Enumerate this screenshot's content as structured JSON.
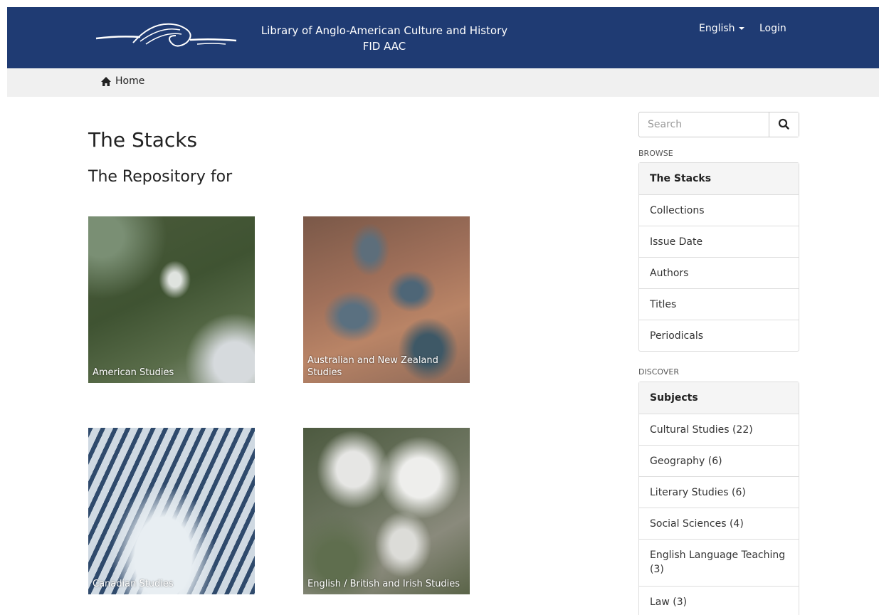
{
  "header": {
    "title_line1": "Library of Anglo-American Culture and History",
    "title_line2": "FID AAC",
    "language_label": "English",
    "login_label": "Login",
    "bg_color": "#1f3b73"
  },
  "breadcrumb": {
    "home_label": "Home",
    "icon": "home-icon"
  },
  "main": {
    "title": "The Stacks",
    "subtitle": "The Repository for",
    "tiles": [
      {
        "caption": "American Studies"
      },
      {
        "caption": "Australian and New Zealand Studies"
      },
      {
        "caption": "Canadian Studies"
      },
      {
        "caption": "English / British and Irish Studies"
      }
    ]
  },
  "search": {
    "placeholder": "Search",
    "icon": "search-icon"
  },
  "browse": {
    "heading": "BROWSE",
    "items": [
      {
        "label": "The Stacks"
      },
      {
        "label": "Collections"
      },
      {
        "label": "Issue Date"
      },
      {
        "label": "Authors"
      },
      {
        "label": "Titles"
      },
      {
        "label": "Periodicals"
      }
    ]
  },
  "discover": {
    "heading": "DISCOVER",
    "header_label": "Subjects",
    "items": [
      {
        "label": "Cultural Studies (22)"
      },
      {
        "label": "Geography (6)"
      },
      {
        "label": "Literary Studies (6)"
      },
      {
        "label": "Social Sciences (4)"
      },
      {
        "label": "English Language Teaching (3)"
      },
      {
        "label": "Law (3)"
      }
    ]
  }
}
